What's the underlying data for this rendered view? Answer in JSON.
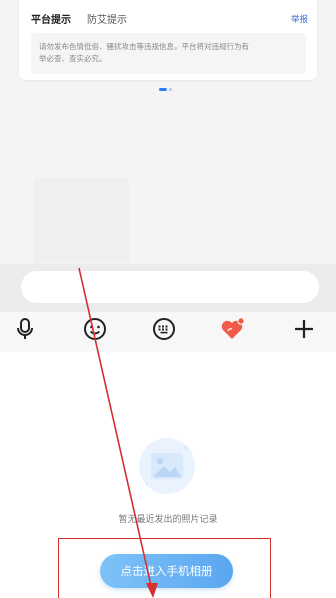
{
  "notice": {
    "tab_active": "平台提示",
    "tab_other": "防艾提示",
    "report": "举报",
    "line1": "请勿发布色情低俗、骚扰攻击等违规信息，平台将对违规行为有",
    "line2": "举必查、查实必究。"
  },
  "input": {
    "placeholder": ""
  },
  "toolbar": {
    "voice": "microphone-icon",
    "emoji": "smile-icon",
    "keyboard": "keyboard-icon",
    "gift": "heart-gift-icon",
    "more": "plus-icon"
  },
  "album": {
    "empty_text": "暂无最近发出的照片记录",
    "button_label": "点击进入手机相册"
  },
  "colors": {
    "accent": "#2c7ef8",
    "button": "#5aa6f0",
    "gift": "#f25a4a",
    "annotation": "#d43030"
  }
}
